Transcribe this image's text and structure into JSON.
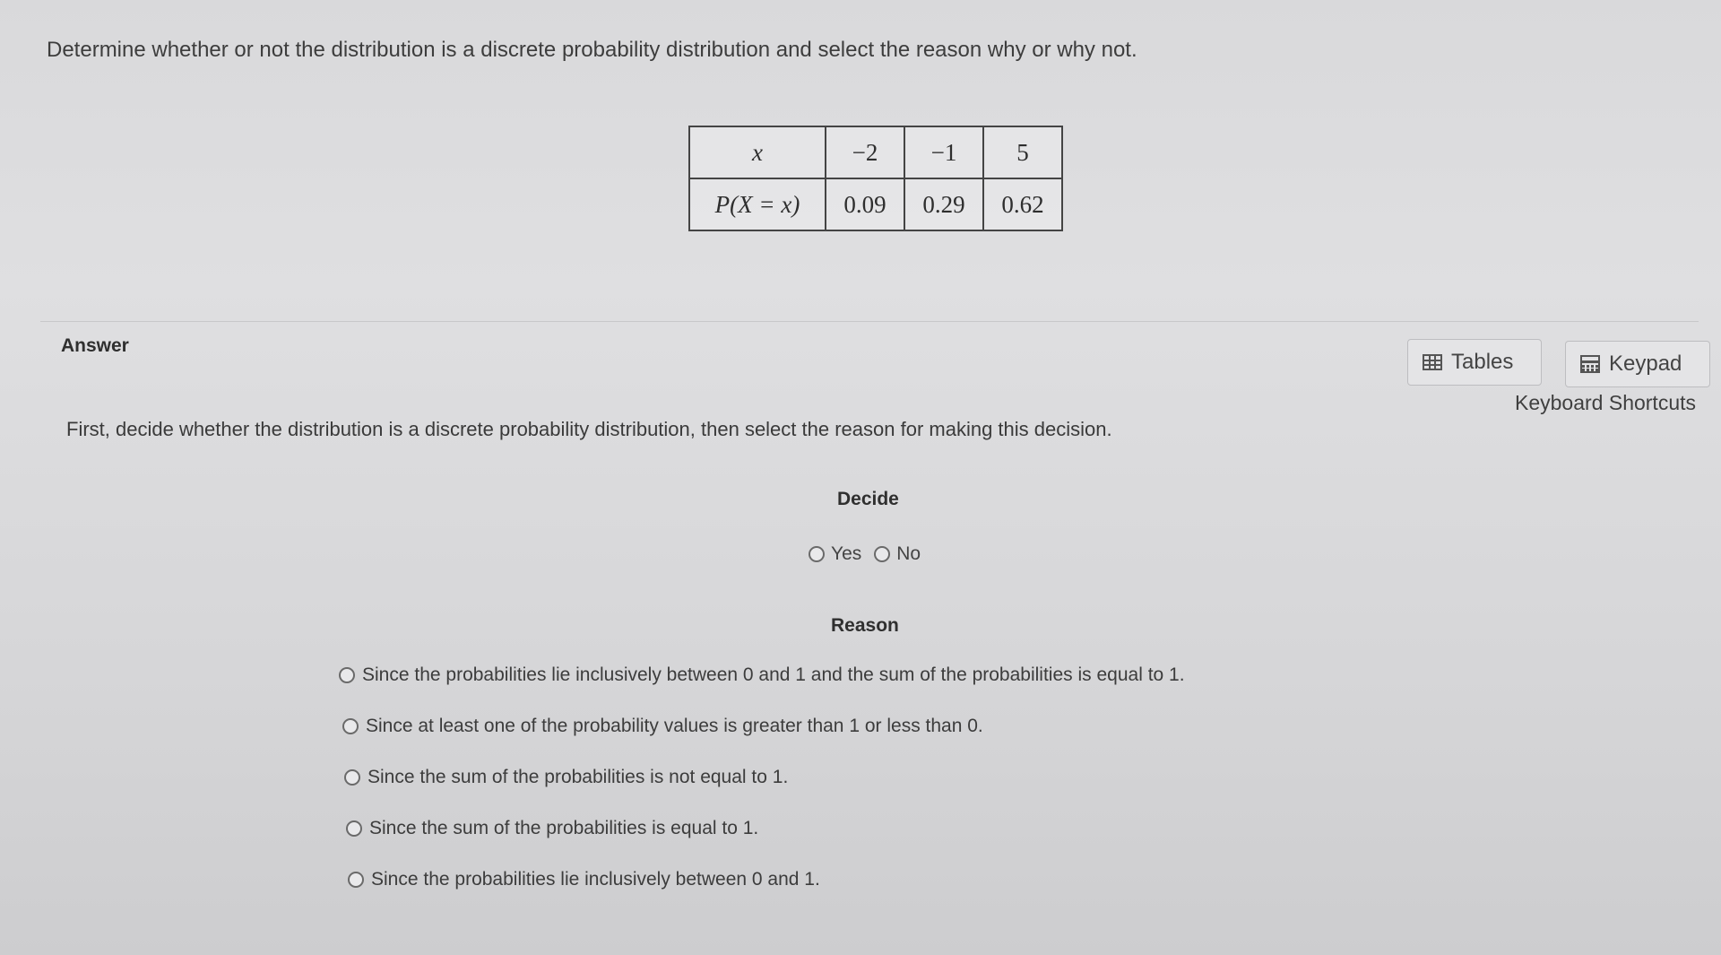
{
  "question": "Determine whether or not the distribution is a discrete probability distribution and select the reason why or why not.",
  "table": {
    "row1_header": "x",
    "row1_values": [
      "−2",
      "−1",
      "5"
    ],
    "row2_header": "P(X = x)",
    "row2_values": [
      "0.09",
      "0.29",
      "0.62"
    ]
  },
  "answer_label": "Answer",
  "tools": {
    "tables_label": "Tables",
    "keypad_label": "Keypad",
    "shortcuts_label": "Keyboard Shortcuts"
  },
  "instruction": "First, decide whether the distribution is a discrete probability distribution, then select the reason for making this decision.",
  "decide": {
    "title": "Decide",
    "options": [
      "Yes",
      "No"
    ]
  },
  "reason": {
    "title": "Reason",
    "options": [
      "Since the probabilities lie inclusively between 0 and 1 and the sum of the probabilities is equal to 1.",
      "Since at least one of the probability values is greater than 1 or less than 0.",
      "Since the sum of the probabilities is not equal to 1.",
      "Since the sum of the probabilities is equal to 1.",
      "Since the probabilities lie inclusively between 0 and 1."
    ]
  }
}
